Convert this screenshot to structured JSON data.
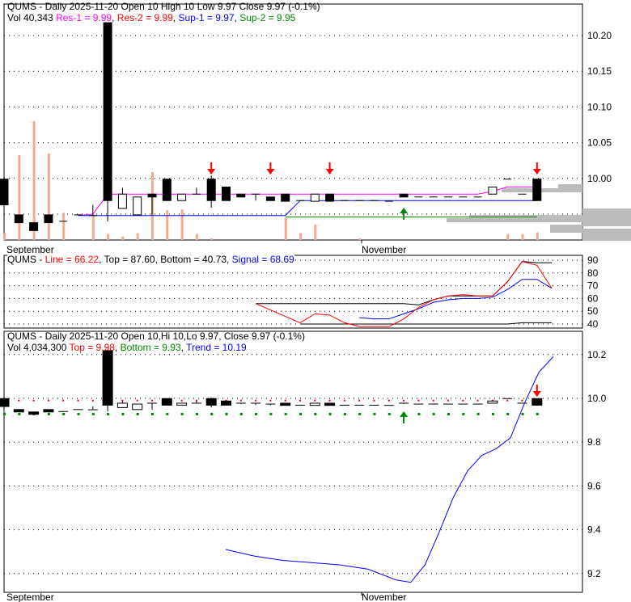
{
  "chart_data": [
    {
      "type": "candlestick",
      "panel": "price",
      "title": "QUMS - Daily 2025-11-20 Open 10  High 10  Low 9.97  Close 9.97 (-0.1%)",
      "legend": {
        "vol": "Vol 40,343",
        "res1": "Res-1 = 9.99",
        "res2": "Res-2 = 9.99",
        "sup1": "Sup-1 = 9.97",
        "sup2": "Sup-2 = 9.95"
      },
      "ylim": [
        9.9,
        10.22
      ],
      "yticks": [
        "10.20",
        "10.15",
        "10.10",
        "10.05",
        "10.00",
        "9.95"
      ],
      "ytick_values": [
        10.2,
        10.15,
        10.1,
        10.05,
        10.0,
        9.95
      ],
      "xlabels": [
        "September",
        "November"
      ],
      "candles": [
        [
          9.999,
          9.999,
          9.963,
          9.963
        ],
        [
          9.949,
          9.949,
          9.938,
          9.938
        ],
        [
          9.938,
          9.938,
          9.927,
          9.927
        ],
        [
          9.949,
          9.949,
          9.938,
          9.938
        ],
        [
          9.94,
          9.94,
          9.94,
          9.94
        ],
        [
          9.949,
          9.949,
          9.949,
          9.949
        ],
        [
          9.948,
          9.963,
          9.948,
          9.948
        ],
        [
          10.218,
          10.218,
          9.94,
          9.969
        ],
        [
          9.958,
          9.987,
          9.958,
          9.978
        ],
        [
          9.949,
          9.974,
          9.949,
          9.974
        ],
        [
          9.978,
          9.978,
          9.949,
          9.974
        ],
        [
          9.999,
          9.999,
          9.969,
          9.969
        ],
        [
          9.969,
          9.978,
          9.969,
          9.978
        ],
        [
          9.978,
          9.987,
          9.978,
          9.978
        ],
        [
          9.999,
          10.004,
          9.959,
          9.969
        ],
        [
          9.988,
          9.988,
          9.969,
          9.969
        ],
        [
          9.978,
          9.978,
          9.974,
          9.974
        ],
        [
          9.978,
          9.978,
          9.969,
          9.978
        ],
        [
          9.974,
          9.974,
          9.969,
          9.969
        ],
        [
          9.978,
          9.978,
          9.968,
          9.968
        ],
        [
          9.969,
          9.969,
          9.969,
          9.969
        ],
        [
          9.968,
          9.978,
          9.968,
          9.978
        ],
        [
          9.978,
          9.978,
          9.968,
          9.968
        ],
        [
          9.969,
          9.969,
          9.969,
          9.969
        ],
        [
          9.969,
          9.969,
          9.969,
          9.969
        ],
        [
          9.969,
          9.969,
          9.969,
          9.969
        ],
        [
          9.968,
          9.968,
          9.968,
          9.968
        ],
        [
          9.978,
          9.978,
          9.974,
          9.974
        ],
        [
          9.974,
          9.974,
          9.974,
          9.974
        ],
        [
          9.974,
          9.974,
          9.974,
          9.974
        ],
        [
          9.974,
          9.974,
          9.974,
          9.974
        ],
        [
          9.974,
          9.974,
          9.974,
          9.974
        ],
        [
          9.974,
          9.974,
          9.974,
          9.974
        ],
        [
          9.978,
          9.988,
          9.978,
          9.988
        ],
        [
          9.999,
          9.999,
          9.999,
          9.999
        ],
        [
          9.978,
          9.978,
          9.978,
          9.978
        ],
        [
          9.999,
          9.999,
          9.969,
          9.969
        ]
      ],
      "volume_rel": [
        0.08,
        1.0,
        1.4,
        1.02,
        0.32,
        0,
        0.3,
        0.07,
        0.04,
        0.08,
        0.8,
        0.35,
        0.36,
        0.07,
        0.02,
        0,
        0,
        0,
        0,
        0.26,
        0.08,
        0.18,
        0,
        0,
        0.02,
        0,
        0,
        0,
        0,
        0,
        0,
        0,
        0,
        0,
        0.07,
        0.07,
        0.09
      ],
      "res1": [
        null,
        null,
        null,
        null,
        null,
        9.948,
        9.95,
        9.978,
        9.978,
        9.978,
        9.978,
        9.978,
        9.978,
        9.978,
        9.978,
        9.978,
        9.978,
        9.978,
        9.978,
        9.978,
        9.978,
        9.978,
        9.978,
        9.978,
        9.978,
        9.978,
        9.978,
        9.978,
        9.978,
        9.978,
        9.978,
        9.978,
        9.978,
        9.982,
        9.988,
        9.988,
        9.988
      ],
      "sup1": [
        null,
        null,
        null,
        null,
        null,
        9.948,
        9.948,
        9.948,
        9.948,
        9.948,
        9.948,
        9.948,
        9.948,
        9.948,
        9.948,
        9.948,
        9.948,
        9.948,
        9.948,
        9.948,
        9.969,
        9.969,
        9.969,
        9.969,
        9.969,
        9.969,
        9.969,
        9.969,
        9.969,
        9.969,
        9.969,
        9.969,
        9.969,
        9.969,
        9.969,
        9.969,
        9.969
      ],
      "sup2_start": 19,
      "sup2": 9.946,
      "signals": [
        {
          "i": 14,
          "dir": "down"
        },
        {
          "i": 18,
          "dir": "down"
        },
        {
          "i": 22,
          "dir": "down"
        },
        {
          "i": 27,
          "dir": "up"
        },
        {
          "i": 36,
          "dir": "down"
        }
      ]
    },
    {
      "type": "line",
      "panel": "oscillator",
      "legend": {
        "name": "QUMS - ",
        "line": "Line = 66.22",
        "top": "Top = 87.60",
        "bottom": "Bottom = 40.73",
        "signal": "Signal = 68.69"
      },
      "ylim": [
        35,
        95
      ],
      "yticks": [
        "90",
        "80",
        "70",
        "60",
        "50",
        "40"
      ],
      "ytick_values": [
        90,
        80,
        70,
        60,
        50,
        40
      ],
      "start": 17,
      "line": [
        56,
        null,
        null,
        41,
        48,
        47,
        41,
        38,
        38,
        38,
        44,
        53,
        59,
        62,
        63,
        62,
        62,
        73,
        89,
        86,
        68
      ],
      "top": [
        56,
        56,
        56,
        56,
        56,
        56,
        56,
        56,
        56,
        56,
        56,
        55,
        59,
        62,
        62,
        62,
        62,
        73,
        89,
        88,
        88
      ],
      "bottom": [
        null,
        null,
        null,
        40,
        40,
        40,
        40,
        40,
        40,
        40,
        40,
        40,
        40,
        40,
        40,
        40,
        40,
        40,
        41,
        41,
        41
      ],
      "signal": [
        null,
        null,
        null,
        null,
        null,
        null,
        null,
        45,
        44,
        44,
        48,
        52,
        57,
        59,
        60,
        60,
        61,
        67,
        75,
        75,
        68
      ]
    },
    {
      "type": "candlestick",
      "panel": "trend",
      "title": "QUMS - Daily 2025-11-20 Open 10,Hi 10,Lo 9.97, Close 9.97 (-0.1%)",
      "legend": {
        "vol": "Vol 4,034,300",
        "top": "Top = 9.98",
        "bottom": "Bottom = 9.93",
        "trend": "Trend = 10.19"
      },
      "ylim": [
        9.12,
        10.28
      ],
      "yticks": [
        "10.2",
        "10.0",
        "9.8",
        "9.6",
        "9.4",
        "9.2"
      ],
      "ytick_values": [
        10.2,
        10.0,
        9.8,
        9.6,
        9.4,
        9.2
      ],
      "top_line": 9.99,
      "bottom_line": 9.93,
      "trend_start": 15,
      "trend": [
        9.31,
        null,
        9.28,
        null,
        9.26,
        null,
        9.25,
        null,
        9.24,
        null,
        9.22,
        null,
        9.17,
        9.16,
        9.24,
        9.39,
        9.55,
        9.67,
        9.74,
        9.77,
        9.82,
        9.98,
        10.12,
        10.19
      ],
      "signals": [
        {
          "i": 27,
          "dir": "up"
        },
        {
          "i": 36,
          "dir": "down"
        }
      ]
    }
  ]
}
